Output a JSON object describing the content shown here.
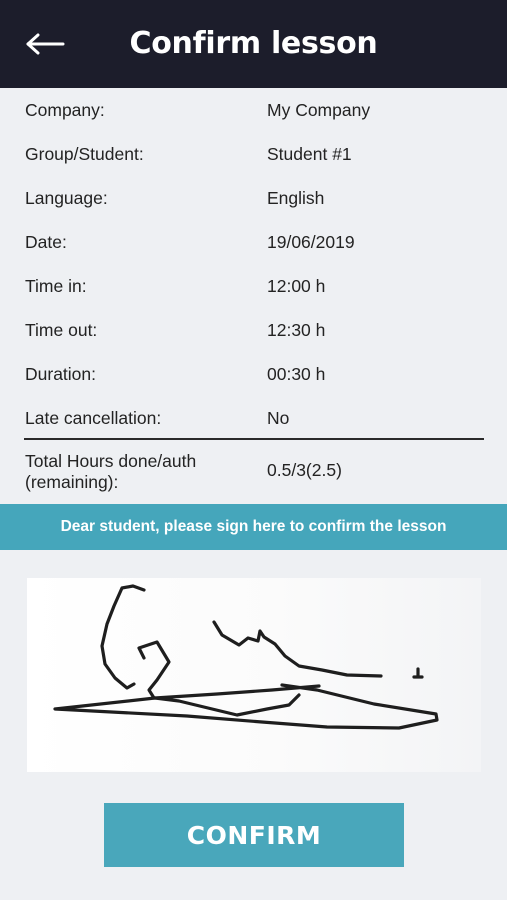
{
  "header": {
    "title": "Confirm lesson",
    "back_icon": "arrow-left-icon"
  },
  "details": [
    {
      "label": "Company:",
      "value": "My Company"
    },
    {
      "label": "Group/Student:",
      "value": "Student #1"
    },
    {
      "label": "Language:",
      "value": "English"
    },
    {
      "label": "Date:",
      "value": "19/06/2019"
    },
    {
      "label": "Time in:",
      "value": "12:00 h"
    },
    {
      "label": "Time out:",
      "value": "12:30 h"
    },
    {
      "label": "Duration:",
      "value": "00:30 h"
    },
    {
      "label": "Late cancellation:",
      "value": "No"
    }
  ],
  "total": {
    "label_line1": "Total Hours done/auth",
    "label_line2": "(remaining):",
    "value": "0.5/3(2.5)"
  },
  "signature": {
    "prompt": "Dear student, please sign here to confirm the lesson"
  },
  "actions": {
    "confirm_label": "CONFIRM"
  },
  "colors": {
    "header_bg": "#1c1d2b",
    "accent": "#45a6bb",
    "page_bg": "#eef0f3"
  }
}
